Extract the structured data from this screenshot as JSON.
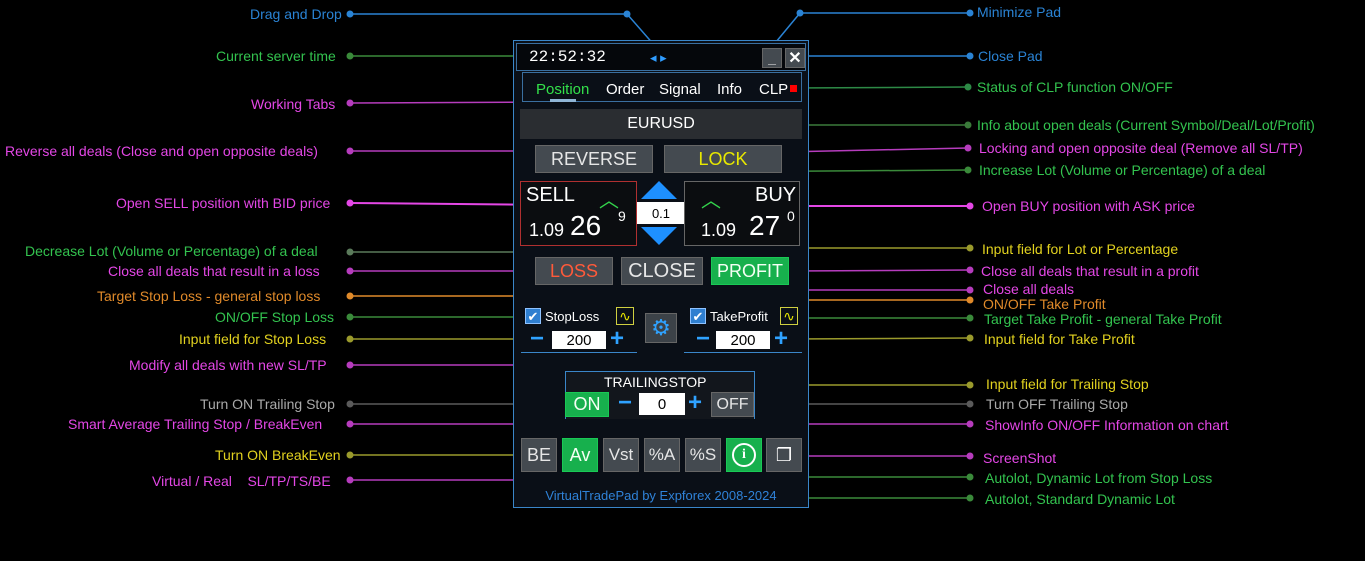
{
  "pad": {
    "server_time": "22:52:32",
    "nav_arrows": "◂ ▸",
    "minimize_label": "_",
    "close_label": "✕",
    "tabs": [
      "Position",
      "Order",
      "Signal",
      "Info",
      "CLP"
    ],
    "active_tab": "Position",
    "clp_status_color": "#ff0000",
    "info_symbol": "EURUSD",
    "reverse_label": "REVERSE",
    "lock_label": "LOCK",
    "sell": {
      "label": "SELL",
      "price_prefix": "1.09",
      "price_big": "26",
      "price_sup": "9"
    },
    "buy": {
      "label": "BUY",
      "price_prefix": "1.09",
      "price_big": "27",
      "price_sup": "0"
    },
    "lot_value": "0.1",
    "loss_label": "LOSS",
    "close_label_main": "CLOSE",
    "profit_label": "PROFIT",
    "stoploss": {
      "label": "StopLoss",
      "value": "200",
      "checked": true
    },
    "takeprofit": {
      "label": "TakeProfit",
      "value": "200",
      "checked": true
    },
    "trailing": {
      "title": "TRAILINGSTOP",
      "on_label": "ON",
      "value": "0",
      "off_label": "OFF"
    },
    "bottom_buttons": [
      "BE",
      "Av",
      "Vst",
      "%A",
      "%S"
    ],
    "footer": "VirtualTradePad by Expforex 2008-2024"
  },
  "annotations_left": {
    "drag_drop": "Drag and Drop",
    "server_time": "Current server time",
    "working_tabs": "Working Tabs",
    "reverse": "Reverse all deals (Close and open opposite deals)",
    "open_sell": "Open SELL position with BID price",
    "decrease_lot": "Decrease Lot (Volume or Percentage) of a deal",
    "close_loss": "Close all deals that result in a loss",
    "target_sl": "Target Stop Loss - general stop loss",
    "onoff_sl": "ON/OFF Stop Loss",
    "input_sl": "Input field for Stop Loss",
    "modify": "Modify all deals with new SL/TP",
    "turn_on_ts": "Turn ON Trailing Stop",
    "smart_avg": "Smart Average Trailing Stop / BreakEven",
    "turn_on_be": "Turn ON BreakEven",
    "virtual_real": "Virtual / Real    SL/TP/TS/BE"
  },
  "annotations_right": {
    "minimize": "Minimize Pad",
    "close_pad": "Close Pad",
    "clp_status": "Status of CLP function ON/OFF",
    "info_deals": "Info about open deals (Current Symbol/Deal/Lot/Profit)",
    "locking": "Locking and open opposite deal (Remove all SL/TP)",
    "increase_lot": "Increase Lot (Volume or Percentage) of a deal",
    "open_buy": "Open BUY position with ASK price",
    "input_lot": "Input field for Lot or Percentage",
    "close_profit": "Close all deals that result in a profit",
    "close_all": "Close all deals",
    "onoff_tp": "ON/OFF Take Profit",
    "target_tp": "Target Take Profit - general Take Profit",
    "input_tp": "Input field for Take Profit",
    "input_ts": "Input field for Trailing Stop",
    "turn_off_ts": "Turn OFF Trailing Stop",
    "showinfo": "ShowInfo ON/OFF Information on chart",
    "screenshot": "ScreenShot",
    "autolot_sl": "Autolot, Dynamic Lot from Stop Loss",
    "autolot_std": "Autolot, Standard Dynamic Lot"
  },
  "colors": {
    "blue": "#2a83d4",
    "green": "#33c34f",
    "magenta": "#e447e6",
    "orange": "#e08a2a",
    "yellow": "#e2d21f",
    "gray": "#9c9c9c",
    "olive": "#9a9a2c"
  }
}
